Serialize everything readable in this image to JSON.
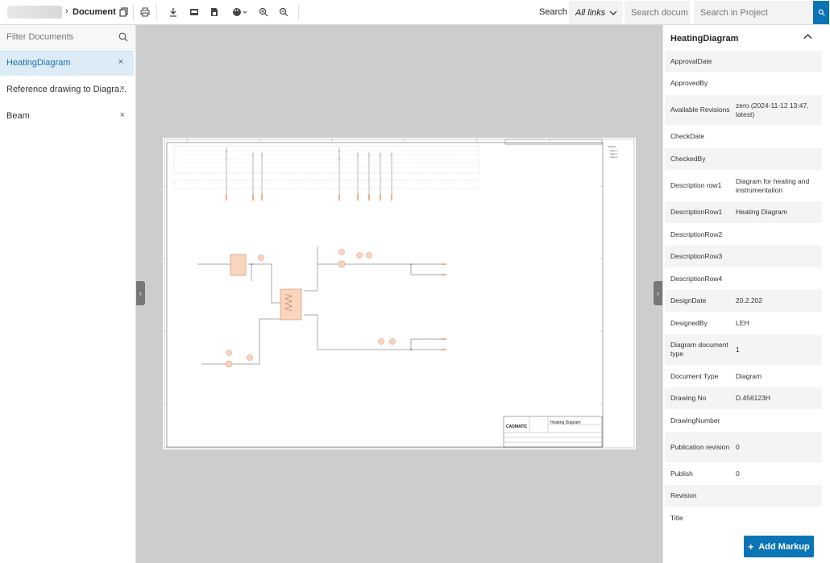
{
  "toolbar": {
    "breadcrumb_title": "Document",
    "search_label": "Search",
    "links_value": "All links",
    "search_doc_placeholder": "Search docum",
    "search_project_placeholder": "Search in Project",
    "icons": [
      "copy-icon",
      "print-icon",
      "download-icon",
      "image-icon",
      "save-icon",
      "palette-icon",
      "zoom-in-icon",
      "zoom-out-icon",
      "search-icon"
    ]
  },
  "left": {
    "filter_placeholder": "Filter Documents",
    "documents": [
      {
        "label": "HeatingDiagram",
        "close": "×"
      },
      {
        "label": "Reference drawing to Diagra...",
        "close": "×"
      },
      {
        "label": "Beam",
        "close": "×"
      }
    ]
  },
  "viewer": {
    "left_toggle": "‹",
    "right_toggle": "›"
  },
  "right": {
    "title": "HeatingDiagram",
    "properties": [
      {
        "key": "ApprovalDate",
        "value": ""
      },
      {
        "key": "ApprovedBy",
        "value": ""
      },
      {
        "key": "Available Revisions",
        "value": "zero (2024-11-12 13:47, latest)"
      },
      {
        "key": "CheckDate",
        "value": ""
      },
      {
        "key": "CheckedBy",
        "value": ""
      },
      {
        "key": "Description row1",
        "value": "Diagram for heating and instrumentation"
      },
      {
        "key": "DescriptionRow1",
        "value": "Heating Diagram"
      },
      {
        "key": "DescriptionRow2",
        "value": ""
      },
      {
        "key": "DescriptionRow3",
        "value": ""
      },
      {
        "key": "DescriptionRow4",
        "value": ""
      },
      {
        "key": "DesignDate",
        "value": "20.2.202"
      },
      {
        "key": "DesignedBy",
        "value": "LEH"
      },
      {
        "key": "Diagram document type",
        "value": "1"
      },
      {
        "key": "Document Type",
        "value": "Diagram"
      },
      {
        "key": "Drawing No",
        "value": "D.456123H"
      },
      {
        "key": "DrawingNumber",
        "value": ""
      },
      {
        "key": "Publication revision",
        "value": "0"
      },
      {
        "key": "Publish",
        "value": "0"
      },
      {
        "key": "Revision",
        "value": ""
      },
      {
        "key": "Title",
        "value": ""
      }
    ],
    "add_markup_label": "Add Markup"
  },
  "drawing": {
    "company": "CADMATIC",
    "title": "Heating Diagram",
    "accent": "#f5c9ae"
  }
}
